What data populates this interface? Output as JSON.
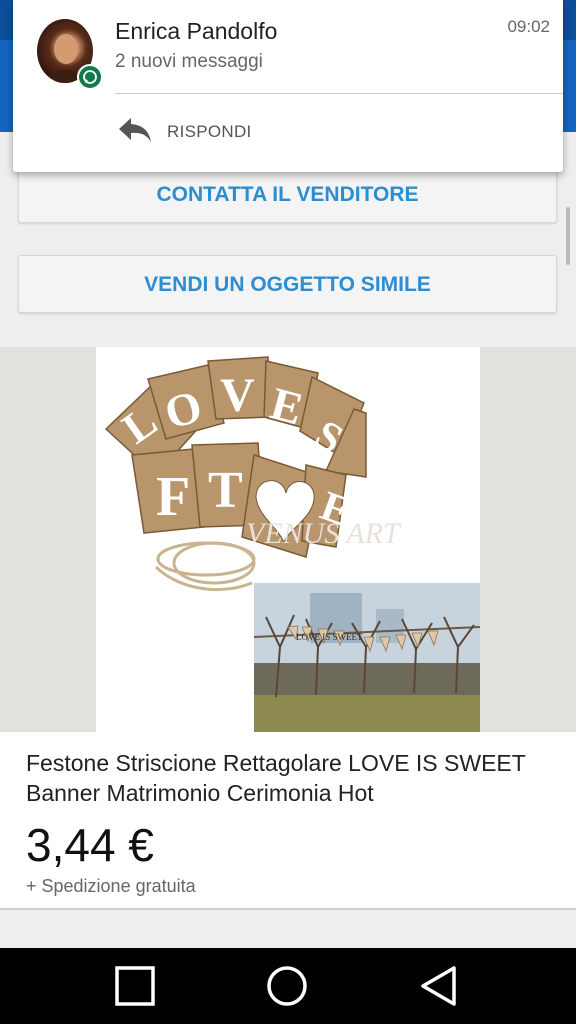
{
  "notification": {
    "sender": "Enrica Pandolfo",
    "message": "2 nuovi messaggi",
    "time": "09:02",
    "reply_label": "RISPONDI",
    "app_icon": "whatsapp-icon"
  },
  "actions": {
    "contact_seller": "CONTATTA IL VENDITORE",
    "sell_similar": "VENDI UN OGGETTO SIMILE"
  },
  "product": {
    "title": "Festone Striscione Rettagolare LOVE IS SWEET Banner Matrimonio Cerimonia Hot",
    "price": "3,44 €",
    "shipping": "+ Spedizione gratuita",
    "image_banner_text": "LOVE IS SWEET"
  },
  "navigation": {
    "recent_icon": "square-icon",
    "home_icon": "circle-icon",
    "back_icon": "triangle-back-icon"
  },
  "colors": {
    "app_bar": "#1565c0",
    "status_bar": "#0d4f9a",
    "accent": "#2c8ed1",
    "whatsapp": "#0f7a4b"
  }
}
